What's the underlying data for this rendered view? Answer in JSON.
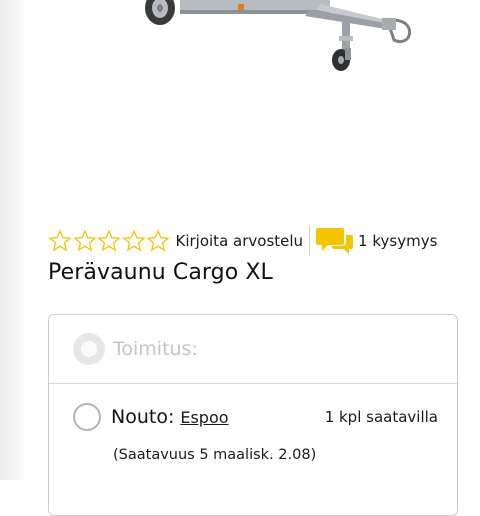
{
  "rating": {
    "stars_filled": 0,
    "stars_total": 5,
    "star_outline_color": "#f2c200",
    "write_review_label": "Kirjoita arvostelu"
  },
  "questions": {
    "icon": "chat-bubbles-icon",
    "icon_color": "#f5c400",
    "label": "1 kysymys"
  },
  "product": {
    "title": "Perävaunu Cargo XL",
    "image_alt": "trailer-image"
  },
  "delivery": {
    "section_label": "Toimitus:",
    "pickup": {
      "label": "Nouto:",
      "store": "Espoo",
      "stock": "1 kpl saatavilla",
      "note": "(Saatavuus 5 maalisk. 2.08)"
    }
  }
}
